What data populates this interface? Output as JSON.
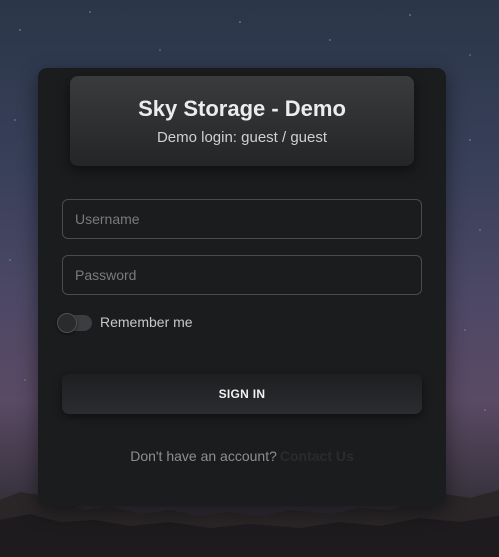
{
  "login": {
    "title": "Sky Storage - Demo",
    "subtitle": "Demo login: guest / guest",
    "username_placeholder": "Username",
    "password_placeholder": "Password",
    "remember_label": "Remember me",
    "remember_checked": false,
    "signin_label": "SIGN IN",
    "footer_text": "Don't have an account?",
    "contact_label": "Contact Us"
  },
  "colors": {
    "card": "#1b1c1e",
    "text": "#ececec"
  }
}
